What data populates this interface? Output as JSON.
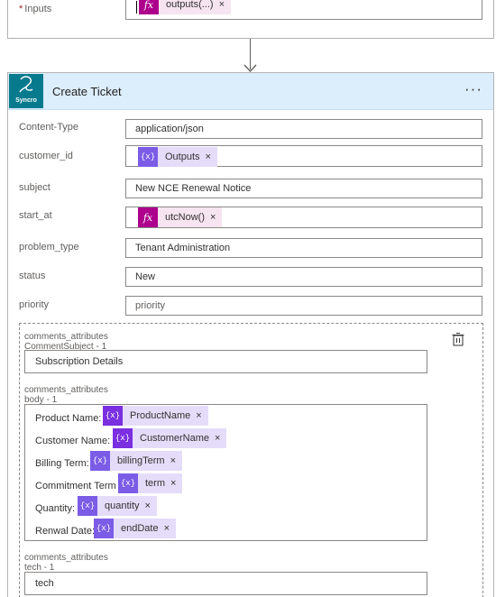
{
  "top": {
    "required_mark": "*",
    "inputs_label": "Inputs",
    "token_icon": "fx",
    "token_label": "outputs(...)",
    "token_remove": "×"
  },
  "card": {
    "logo_text": "Syncro",
    "title": "Create Ticket",
    "more": "···"
  },
  "fields": {
    "content_type": {
      "label": "Content-Type",
      "value": "application/json"
    },
    "customer_id": {
      "label": "customer_id",
      "token_icon": "{x}",
      "token_label": "Outputs",
      "remove": "×"
    },
    "subject": {
      "label": "subject",
      "value": "New NCE Renewal Notice"
    },
    "start_at": {
      "label": "start_at",
      "token_icon": "fx",
      "token_label": "utcNow()",
      "remove": "×"
    },
    "problem_type": {
      "label": "problem_type",
      "value": "Tenant Administration"
    },
    "status": {
      "label": "status",
      "value": "New"
    },
    "priority": {
      "label": "priority",
      "placeholder": "priority"
    }
  },
  "comments": {
    "subject_label_1": "comments_attributes",
    "subject_label_2": "CommentSubject - 1",
    "subject_value": "Subscription Details",
    "body_label_1": "comments_attributes",
    "body_label_2": "body - 1",
    "body_lines": [
      {
        "prefix": "Product Name:",
        "icon": "{x}",
        "token": "ProductName",
        "remove": "×"
      },
      {
        "prefix": "Customer Name:",
        "icon": "{x}",
        "token": "CustomerName",
        "remove": "×"
      },
      {
        "prefix": "Billing Term:",
        "icon": "{x}",
        "token": "billingTerm",
        "remove": "×"
      },
      {
        "prefix": "Commitment Term",
        "icon": "{x}",
        "token": "term",
        "remove": "×"
      },
      {
        "prefix": "Quantity:",
        "icon": "{x}",
        "token": "quantity",
        "remove": "×"
      },
      {
        "prefix": "Renwal Date:",
        "icon": "{x}",
        "token": "endDate",
        "remove": "×"
      }
    ],
    "tech_label_1": "comments_attributes",
    "tech_label_2": "tech - 1",
    "tech_value": "tech"
  }
}
